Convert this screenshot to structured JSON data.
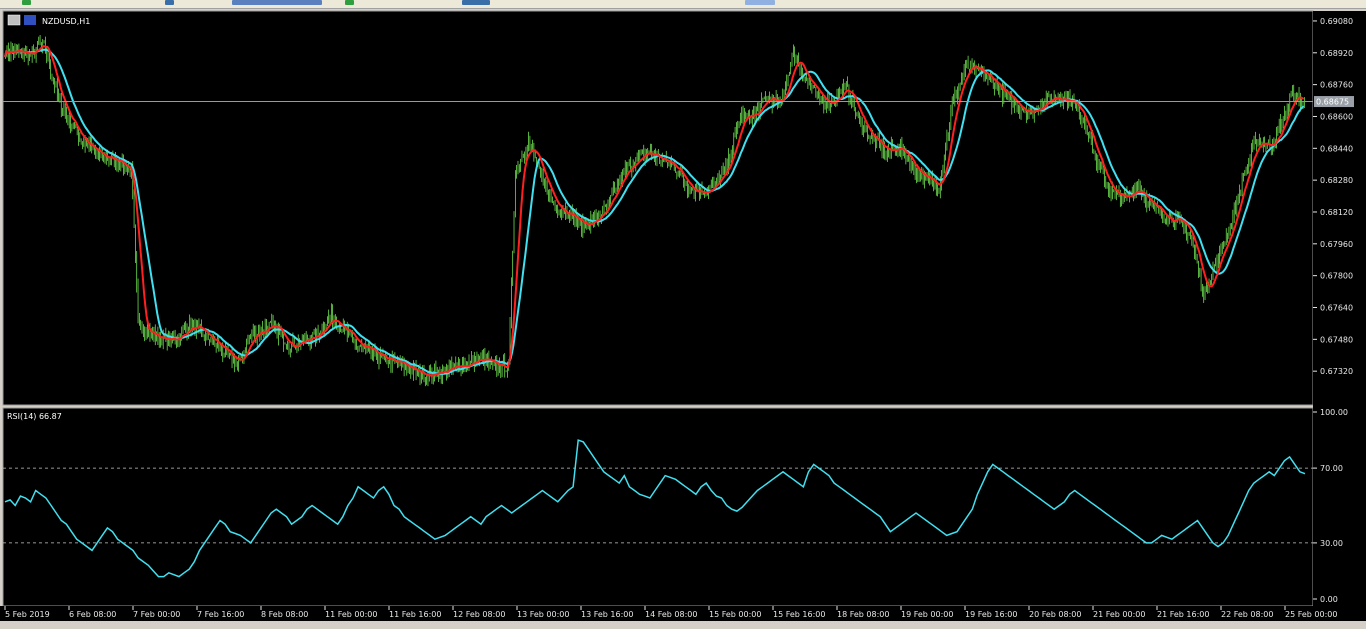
{
  "window": {
    "title": "NZDUSD,H1",
    "icon": "chart-window-icon"
  },
  "colors": {
    "background": "#000000",
    "candle": "#7cfc5a",
    "ma_fast": "#ff2020",
    "ma_slow": "#40e0f0",
    "rsi": "#40e0f0",
    "grid_text": "#e8e8e8",
    "price_line": "#9a9a9a",
    "price_tag_bg": "#9aa0a8"
  },
  "chart_data": [
    {
      "type": "candlestick",
      "title": "NZDUSD,H1",
      "ylim": [
        0.6716,
        0.6912
      ],
      "yticks": [
        "0.69080",
        "0.68920",
        "0.68760",
        "0.68600",
        "0.68440",
        "0.68280",
        "0.68120",
        "0.67960",
        "0.67800",
        "0.67640",
        "0.67480",
        "0.67320"
      ],
      "current_price": "0.68675",
      "x_labels": [
        "5 Feb 2019",
        "6 Feb 08:00",
        "7 Feb 00:00",
        "7 Feb 16:00",
        "8 Feb 08:00",
        "11 Feb 00:00",
        "11 Feb 16:00",
        "12 Feb 08:00",
        "13 Feb 00:00",
        "13 Feb 16:00",
        "14 Feb 08:00",
        "15 Feb 00:00",
        "15 Feb 16:00",
        "18 Feb 08:00",
        "19 Feb 00:00",
        "19 Feb 16:00",
        "20 Feb 08:00",
        "21 Feb 00:00",
        "21 Feb 16:00",
        "22 Feb 08:00",
        "25 Feb 00:00"
      ],
      "close_keypoints": [
        [
          0,
          0.6893
        ],
        [
          10,
          0.6892
        ],
        [
          20,
          0.6891
        ],
        [
          25,
          0.6896
        ],
        [
          30,
          0.6894
        ],
        [
          40,
          0.6868
        ],
        [
          55,
          0.685
        ],
        [
          70,
          0.684
        ],
        [
          85,
          0.6838
        ],
        [
          95,
          0.6832
        ],
        [
          100,
          0.6758
        ],
        [
          110,
          0.675
        ],
        [
          125,
          0.6747
        ],
        [
          140,
          0.6755
        ],
        [
          160,
          0.6745
        ],
        [
          175,
          0.6735
        ],
        [
          185,
          0.675
        ],
        [
          200,
          0.6755
        ],
        [
          215,
          0.6745
        ],
        [
          235,
          0.675
        ],
        [
          245,
          0.676
        ],
        [
          255,
          0.6753
        ],
        [
          265,
          0.6745
        ],
        [
          285,
          0.6738
        ],
        [
          300,
          0.6735
        ],
        [
          315,
          0.673
        ],
        [
          330,
          0.6732
        ],
        [
          345,
          0.6735
        ],
        [
          360,
          0.6738
        ],
        [
          370,
          0.6734
        ],
        [
          380,
          0.6735
        ],
        [
          385,
          0.6832
        ],
        [
          395,
          0.6848
        ],
        [
          405,
          0.6828
        ],
        [
          415,
          0.6815
        ],
        [
          425,
          0.6812
        ],
        [
          435,
          0.6805
        ],
        [
          445,
          0.6808
        ],
        [
          455,
          0.6815
        ],
        [
          465,
          0.683
        ],
        [
          475,
          0.6838
        ],
        [
          485,
          0.6842
        ],
        [
          495,
          0.6838
        ],
        [
          505,
          0.6835
        ],
        [
          515,
          0.6825
        ],
        [
          525,
          0.6822
        ],
        [
          535,
          0.6825
        ],
        [
          545,
          0.6835
        ],
        [
          555,
          0.686
        ],
        [
          565,
          0.686
        ],
        [
          575,
          0.687
        ],
        [
          585,
          0.6865
        ],
        [
          595,
          0.6892
        ],
        [
          605,
          0.6878
        ],
        [
          615,
          0.6868
        ],
        [
          625,
          0.6868
        ],
        [
          635,
          0.6875
        ],
        [
          645,
          0.6858
        ],
        [
          655,
          0.6848
        ],
        [
          665,
          0.6842
        ],
        [
          675,
          0.6845
        ],
        [
          685,
          0.6835
        ],
        [
          695,
          0.6828
        ],
        [
          705,
          0.6825
        ],
        [
          715,
          0.6865
        ],
        [
          725,
          0.6885
        ],
        [
          735,
          0.6882
        ],
        [
          745,
          0.6878
        ],
        [
          755,
          0.687
        ],
        [
          765,
          0.6865
        ],
        [
          775,
          0.6862
        ],
        [
          785,
          0.6868
        ],
        [
          795,
          0.687
        ],
        [
          805,
          0.6868
        ],
        [
          815,
          0.6858
        ],
        [
          825,
          0.6835
        ],
        [
          835,
          0.6822
        ],
        [
          845,
          0.6818
        ],
        [
          855,
          0.6825
        ],
        [
          865,
          0.6815
        ],
        [
          875,
          0.681
        ],
        [
          885,
          0.6808
        ],
        [
          895,
          0.68
        ],
        [
          905,
          0.677
        ],
        [
          915,
          0.6788
        ],
        [
          925,
          0.6805
        ],
        [
          935,
          0.683
        ],
        [
          945,
          0.6848
        ],
        [
          955,
          0.6845
        ],
        [
          965,
          0.6858
        ],
        [
          972,
          0.6872
        ],
        [
          980,
          0.6866
        ]
      ],
      "series": [
        {
          "type": "candles"
        },
        {
          "type": "moving-average",
          "period": 10
        },
        {
          "type": "moving-average",
          "period": 20
        }
      ]
    },
    {
      "type": "line",
      "title": "RSI(14) 66.87",
      "ylim": [
        0,
        100
      ],
      "yticks": [
        "100.00",
        "70.00",
        "30.00",
        "0.00"
      ],
      "levels": [
        70,
        30
      ],
      "series": [
        {
          "values": [
            52,
            53,
            50,
            55,
            54,
            52,
            58,
            56,
            54,
            50,
            46,
            42,
            40,
            36,
            32,
            30,
            28,
            26,
            30,
            34,
            38,
            36,
            32,
            30,
            28,
            26,
            22,
            20,
            18,
            15,
            12,
            12,
            14,
            13,
            12,
            14,
            16,
            20,
            26,
            30,
            34,
            38,
            42,
            40,
            36,
            35,
            34,
            32,
            30,
            34,
            38,
            42,
            46,
            48,
            46,
            44,
            40,
            42,
            44,
            48,
            50,
            48,
            46,
            44,
            42,
            40,
            44,
            50,
            54,
            60,
            58,
            56,
            54,
            58,
            60,
            56,
            50,
            48,
            44,
            42,
            40,
            38,
            36,
            34,
            32,
            33,
            34,
            36,
            38,
            40,
            42,
            44,
            42,
            40,
            44,
            46,
            48,
            50,
            48,
            46,
            48,
            50,
            52,
            54,
            56,
            58,
            56,
            54,
            52,
            55,
            58,
            60,
            85,
            84,
            80,
            76,
            72,
            68,
            66,
            64,
            62,
            66,
            60,
            58,
            56,
            55,
            54,
            58,
            62,
            66,
            65,
            64,
            62,
            60,
            58,
            56,
            60,
            62,
            58,
            55,
            54,
            50,
            48,
            47,
            49,
            52,
            55,
            58,
            60,
            62,
            64,
            66,
            68,
            66,
            64,
            62,
            60,
            68,
            72,
            70,
            68,
            66,
            62,
            60,
            58,
            56,
            54,
            52,
            50,
            48,
            46,
            44,
            40,
            36,
            38,
            40,
            42,
            44,
            46,
            44,
            42,
            40,
            38,
            36,
            34,
            35,
            36,
            40,
            44,
            48,
            56,
            62,
            68,
            72,
            70,
            68,
            66,
            64,
            62,
            60,
            58,
            56,
            54,
            52,
            50,
            48,
            50,
            52,
            56,
            58,
            56,
            54,
            52,
            50,
            48,
            46,
            44,
            42,
            40,
            38,
            36,
            34,
            32,
            30,
            30,
            32,
            34,
            33,
            32,
            34,
            36,
            38,
            40,
            42,
            38,
            34,
            30,
            28,
            30,
            34,
            40,
            46,
            52,
            58,
            62,
            64,
            66,
            68,
            66,
            70,
            74,
            76,
            72,
            68,
            67
          ]
        }
      ]
    }
  ]
}
